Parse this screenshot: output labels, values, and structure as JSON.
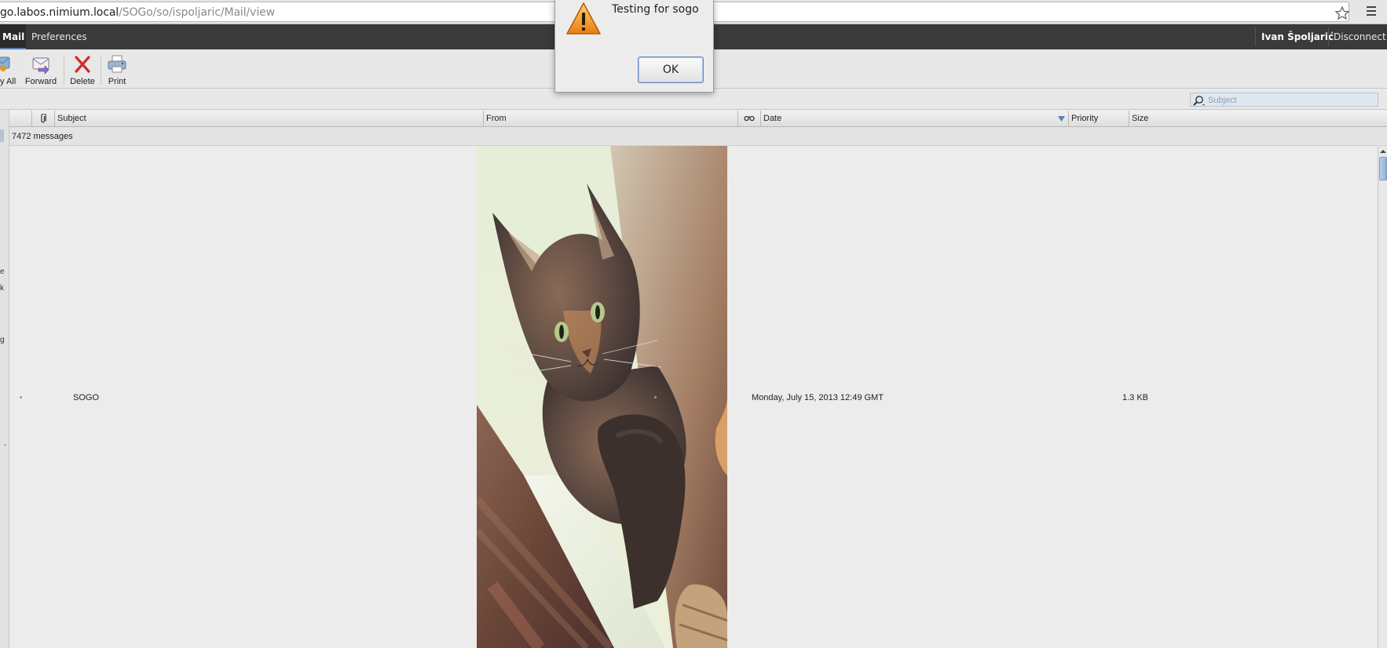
{
  "browser": {
    "url_host": "go.labos.nimium.local",
    "url_path": "/SOGo/so/ispoljaric/Mail/view",
    "icons": [
      "star-icon",
      "menu-icon"
    ]
  },
  "topnav": {
    "mail": "Mail",
    "preferences": "Preferences",
    "user": "Ivan Špoljarić",
    "disconnect": "Disconnect"
  },
  "toolbar": {
    "reply_all": "y All",
    "forward": "Forward",
    "delete": "Delete",
    "print": "Print"
  },
  "search": {
    "placeholder": "Subject"
  },
  "left_strip": {
    "fragments": [
      "e",
      "k",
      "g",
      "¸"
    ]
  },
  "columns": {
    "subject": "Subject",
    "from": "From",
    "date": "Date",
    "priority": "Priority",
    "size": "Size"
  },
  "list": {
    "count": "7472 messages",
    "message": {
      "subject": "SOGO",
      "date": "Monday, July 15, 2013 12:49 GMT",
      "size": "1.3 KB"
    }
  },
  "alert": {
    "message": "Testing for sogo",
    "ok": "OK"
  },
  "colors": {
    "nav_bg": "#3a3a3a",
    "accent": "#5e7fb1",
    "delete_red": "#d22a2a"
  }
}
